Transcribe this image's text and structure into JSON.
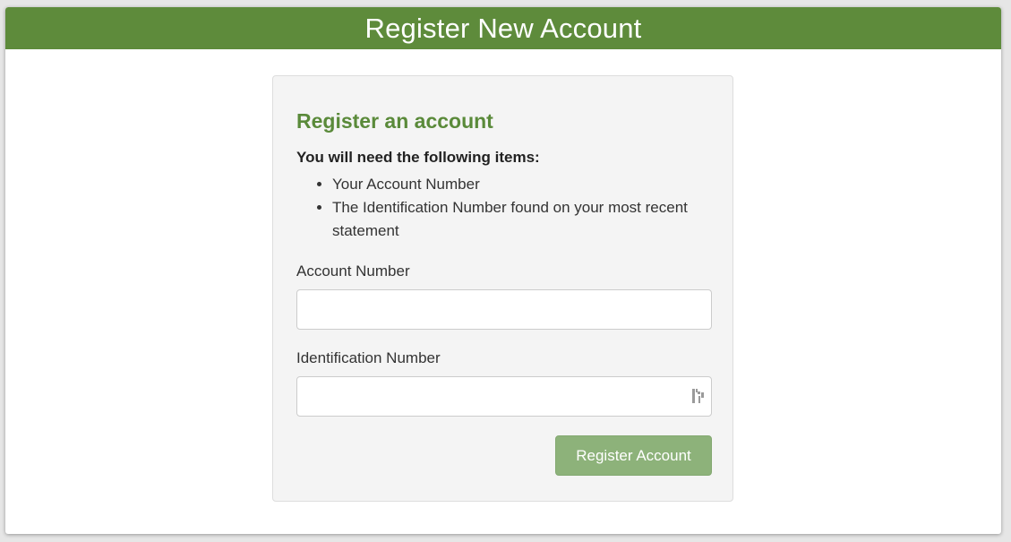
{
  "header": {
    "title": "Register New Account"
  },
  "form": {
    "title": "Register an account",
    "intro": "You will need the following items:",
    "requirements": [
      "Your Account Number",
      "The Identification Number found on your most recent statement"
    ],
    "account_label": "Account Number",
    "account_value": "",
    "id_label": "Identification Number",
    "id_value": "",
    "submit_label": "Register Account"
  },
  "icons": {
    "password_manager": "password-manager-icon"
  },
  "colors": {
    "header_bg": "#5e8b3b",
    "title": "#5a8a3a",
    "button_bg": "#8db27a",
    "card_bg": "#f4f4f4"
  }
}
